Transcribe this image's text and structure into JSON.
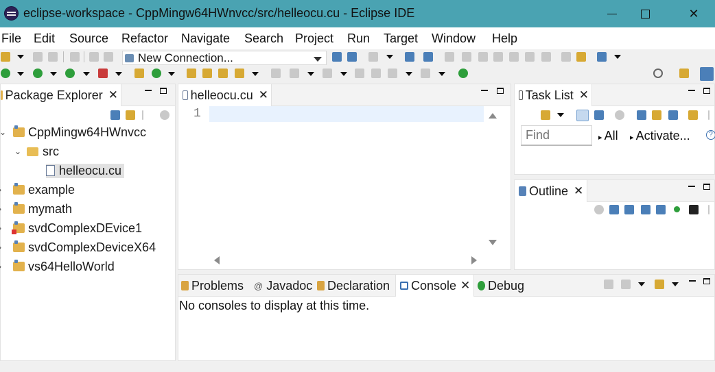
{
  "window": {
    "title": "eclipse-workspace - CppMingw64HWnvcc/src/helleocu.cu - Eclipse IDE",
    "minimize_icon": "minimize-icon",
    "maximize_icon": "maximize-icon",
    "close_glyph": "✕"
  },
  "menu": [
    "File",
    "Edit",
    "Source",
    "Refactor",
    "Navigate",
    "Search",
    "Project",
    "Run",
    "Target",
    "Window",
    "Help"
  ],
  "toolbar": {
    "connection_combo": "New Connection..."
  },
  "package_explorer": {
    "title": "Package Explorer",
    "close": "✕",
    "tree": [
      {
        "label": "CppMingw64HWnvcc",
        "expanded": true
      },
      {
        "label": "src",
        "expanded": true
      },
      {
        "label": "helleocu.cu",
        "selected": true
      },
      {
        "label": "example"
      },
      {
        "label": "mymath"
      },
      {
        "label": "svdComplexDEvice1",
        "error": true
      },
      {
        "label": "svdComplexDeviceX64"
      },
      {
        "label": "vs64HelloWorld"
      }
    ]
  },
  "editor": {
    "tab_label": "helleocu.cu",
    "close": "✕",
    "line_number": "1"
  },
  "task_list": {
    "title": "Task List",
    "close": "✕",
    "find_placeholder": "Find",
    "filter_all": "All",
    "filter_activate": "Activate...",
    "help": "?"
  },
  "outline": {
    "title": "Outline",
    "close": "✕"
  },
  "bottom_tabs": {
    "problems": "Problems",
    "javadoc": "Javadoc",
    "declaration": "Declaration",
    "console": "Console",
    "debug": "Debug",
    "close": "✕",
    "javadoc_glyph": "@"
  },
  "console": {
    "message": "No consoles to display at this time."
  }
}
